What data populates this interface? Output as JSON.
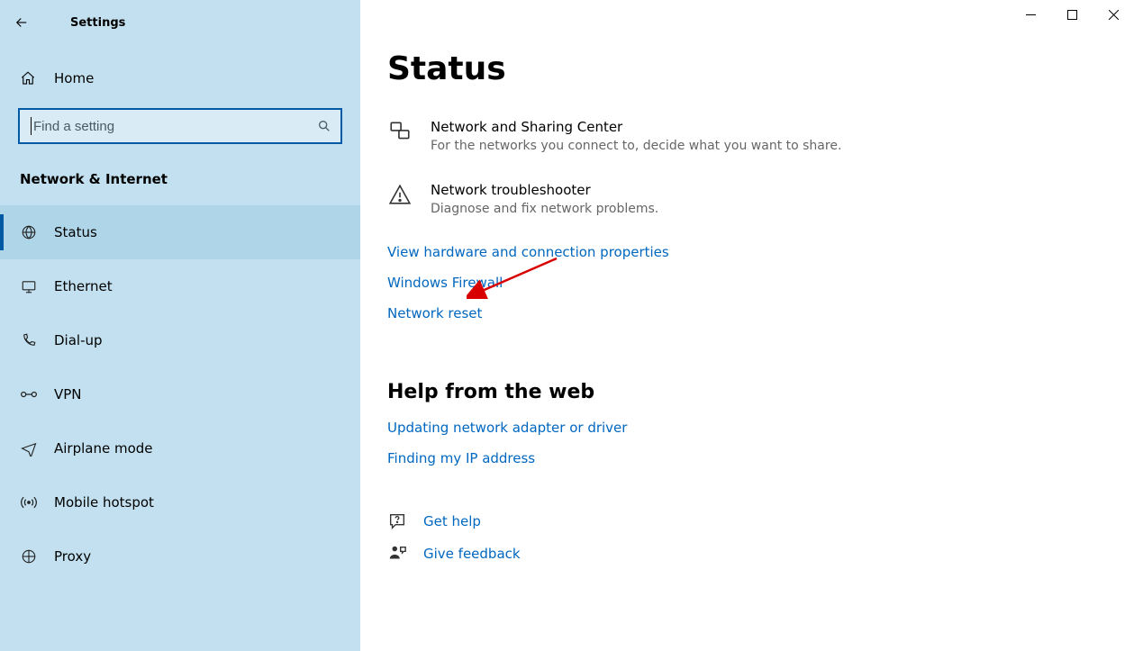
{
  "app_title": "Settings",
  "home_label": "Home",
  "search": {
    "placeholder": "Find a setting"
  },
  "category": "Network & Internet",
  "nav": {
    "items": [
      {
        "label": "Status"
      },
      {
        "label": "Ethernet"
      },
      {
        "label": "Dial-up"
      },
      {
        "label": "VPN"
      },
      {
        "label": "Airplane mode"
      },
      {
        "label": "Mobile hotspot"
      },
      {
        "label": "Proxy"
      }
    ],
    "selected_index": 0
  },
  "main": {
    "title": "Status",
    "items": [
      {
        "title": "Network and Sharing Center",
        "sub": "For the networks you connect to, decide what you want to share."
      },
      {
        "title": "Network troubleshooter",
        "sub": "Diagnose and fix network problems."
      }
    ],
    "links": [
      "View hardware and connection properties",
      "Windows Firewall",
      "Network reset"
    ],
    "help_section_title": "Help from the web",
    "help_links": [
      "Updating network adapter or driver",
      "Finding my IP address"
    ],
    "footer": {
      "get_help": "Get help",
      "give_feedback": "Give feedback"
    }
  },
  "colors": {
    "accent": "#005aa3",
    "link": "#0067c0",
    "sidebar_bg": "#c2e0ef",
    "annotation": "#d80000"
  }
}
